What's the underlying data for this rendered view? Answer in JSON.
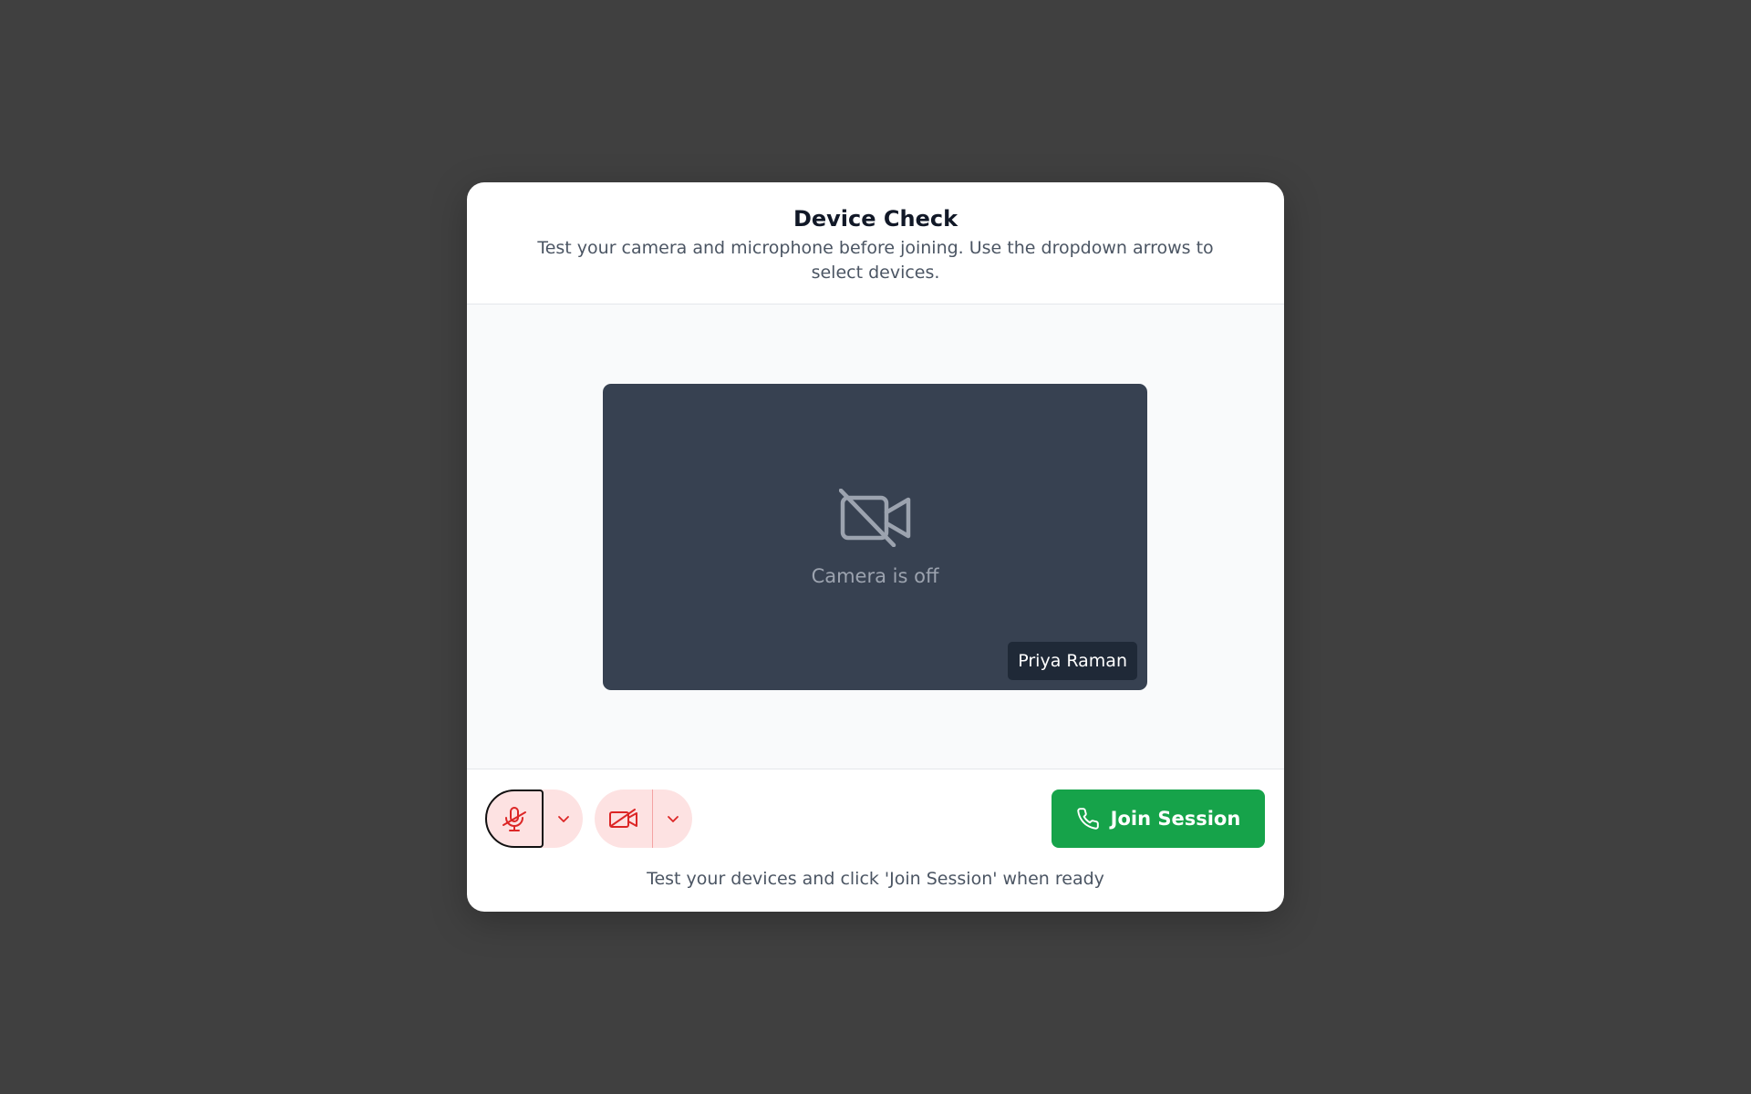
{
  "dialog": {
    "title": "Device Check",
    "subtitle": "Test your camera and microphone before joining. Use the dropdown arrows to select devices."
  },
  "preview": {
    "camera_status": "Camera is off",
    "participant_name": "Priya Raman",
    "icon": "video-off-icon"
  },
  "controls": {
    "microphone": {
      "state": "muted",
      "icon": "mic-off-icon",
      "dropdown_icon": "chevron-down-icon"
    },
    "camera": {
      "state": "off",
      "icon": "video-off-icon",
      "dropdown_icon": "chevron-down-icon"
    },
    "join_button": {
      "label": "Join Session",
      "icon": "phone-icon"
    },
    "hint": "Test your devices and click 'Join Session' when ready"
  },
  "colors": {
    "backdrop": "#404040",
    "video_tile": "#374151",
    "muted_control_bg": "#fde2e2",
    "muted_control_icon": "#dc2626",
    "join_button": "#16a34a"
  }
}
